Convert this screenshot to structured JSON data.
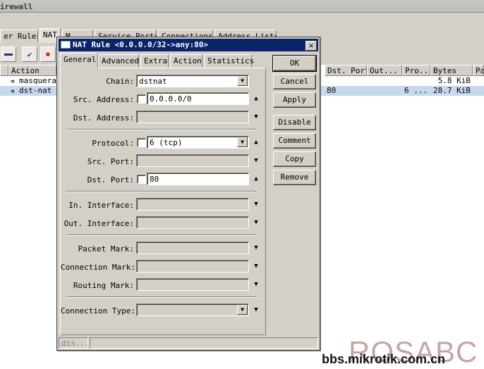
{
  "bg_window": {
    "title": "irewall",
    "tabs": [
      "er Rules",
      "NAT",
      "M...",
      "Service Ports",
      "Connections",
      "Address Lists"
    ],
    "toolbar": [
      "remove",
      "enable",
      "disable"
    ],
    "columns": [
      "Action",
      "Dst. Port",
      "Out...",
      "Pro...",
      "Bytes",
      "Pa"
    ],
    "rows": [
      {
        "action": "masquera",
        "dst_port": "",
        "out": "",
        "pro": "",
        "bytes": "5.8 KiB",
        "selected": false
      },
      {
        "action": "dst-nat",
        "dst_port": "80",
        "out": "",
        "pro": "6 ...",
        "bytes": "28.7 KiB",
        "selected": true
      }
    ]
  },
  "dialog": {
    "title": "NAT Rule <0.0.0.0/32->any:80>",
    "tabs": [
      "General",
      "Advanced",
      "Extra",
      "Action",
      "Statistics"
    ],
    "fields": {
      "chain": {
        "label": "Chain:",
        "value": "dstnat"
      },
      "src_address": {
        "label": "Src. Address:",
        "value": "0.0.0.0/0"
      },
      "dst_address": {
        "label": "Dst. Address:",
        "value": ""
      },
      "protocol": {
        "label": "Protocol:",
        "value": "6 (tcp)"
      },
      "src_port": {
        "label": "Src. Port:",
        "value": ""
      },
      "dst_port": {
        "label": "Dst. Port:",
        "value": "80"
      },
      "in_interface": {
        "label": "In. Interface:",
        "value": ""
      },
      "out_interface": {
        "label": "Out. Interface:",
        "value": ""
      },
      "packet_mark": {
        "label": "Packet Mark:",
        "value": ""
      },
      "connection_mark": {
        "label": "Connection Mark:",
        "value": ""
      },
      "routing_mark": {
        "label": "Routing Mark:",
        "value": ""
      },
      "connection_type": {
        "label": "Connection Type:",
        "value": ""
      }
    },
    "buttons": {
      "ok": "OK",
      "cancel": "Cancel",
      "apply": "Apply",
      "disable": "Disable",
      "comment": "Comment",
      "copy": "Copy",
      "remove": "Remove"
    },
    "status": "dis..."
  },
  "watermark": {
    "logo": "ROSABC",
    "url": "bbs.mikrotik.com.cn"
  }
}
